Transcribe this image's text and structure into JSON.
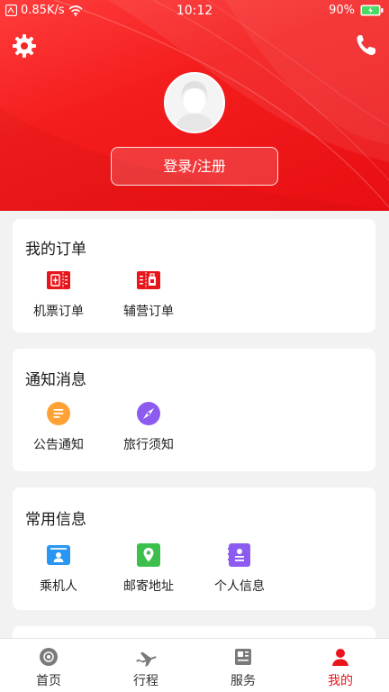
{
  "status_bar": {
    "speed": "0.85K/s",
    "time": "10:12",
    "battery": "90%"
  },
  "header": {
    "login_label": "登录/注册",
    "settings_icon": "gear-icon",
    "phone_icon": "phone-icon"
  },
  "orders": {
    "title": "我的订单",
    "items": [
      {
        "label": "机票订单",
        "icon": "flight-ticket-icon"
      },
      {
        "label": "辅营订单",
        "icon": "ancillary-order-icon"
      }
    ]
  },
  "notices": {
    "title": "通知消息",
    "items": [
      {
        "label": "公告通知",
        "icon": "announcement-icon"
      },
      {
        "label": "旅行须知",
        "icon": "compass-icon"
      }
    ]
  },
  "info": {
    "title": "常用信息",
    "items": [
      {
        "label": "乘机人",
        "icon": "passenger-icon"
      },
      {
        "label": "邮寄地址",
        "icon": "location-icon"
      },
      {
        "label": "个人信息",
        "icon": "personal-info-icon"
      }
    ]
  },
  "tabs": [
    {
      "label": "首页",
      "icon": "home-icon"
    },
    {
      "label": "行程",
      "icon": "plane-icon"
    },
    {
      "label": "服务",
      "icon": "news-icon"
    },
    {
      "label": "我的",
      "icon": "user-icon",
      "active": true
    }
  ],
  "colors": {
    "brand_red": "#e8151b",
    "orange": "#ffa235",
    "purple": "#8c5bef",
    "blue": "#2896f2",
    "green": "#3cbf4b"
  }
}
